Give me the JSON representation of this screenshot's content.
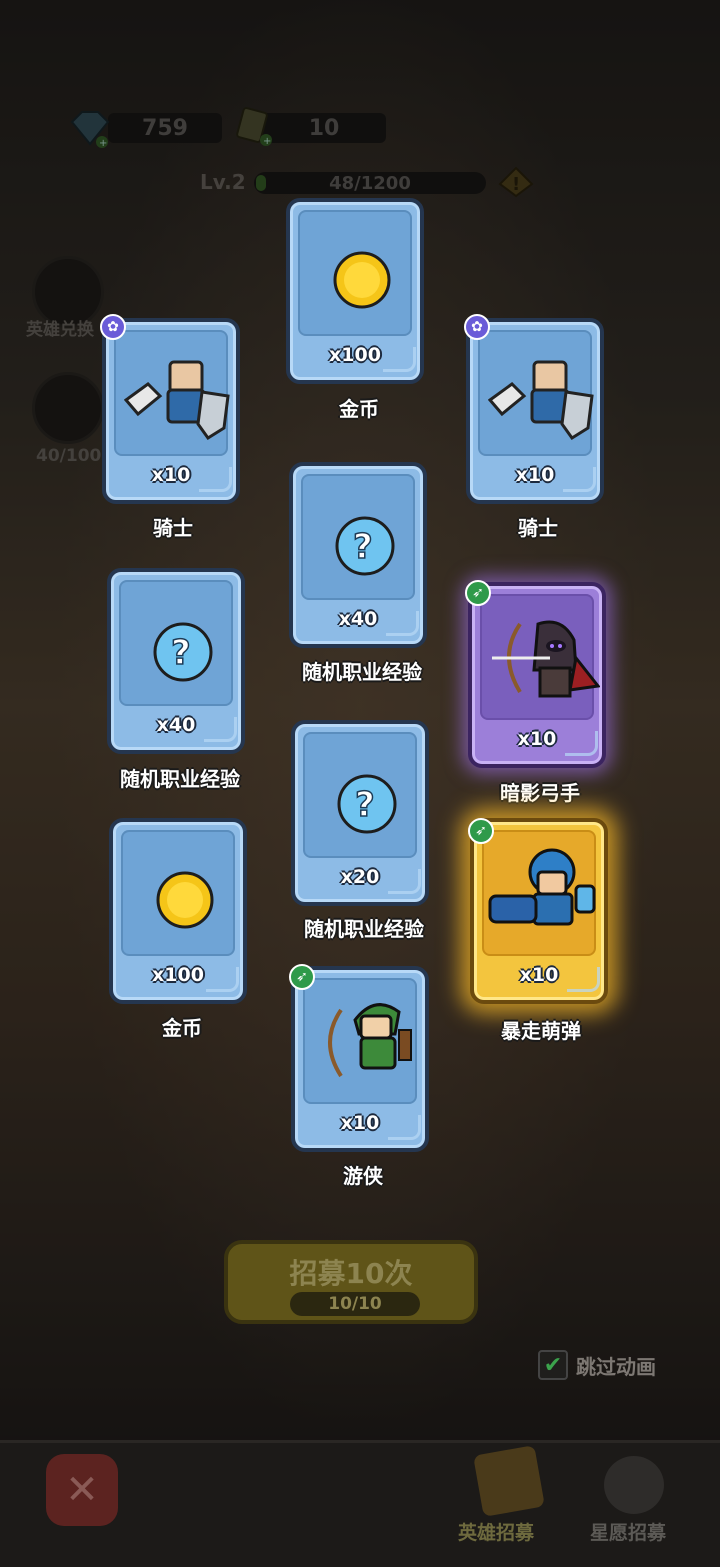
{
  "resources": {
    "gems": "759",
    "tickets": "10"
  },
  "level": {
    "label": "Lv.2",
    "progress_text": "48/1200",
    "progress_fraction": 0.04
  },
  "side": {
    "hero_exchange": "英雄兑换",
    "progress": "40/100"
  },
  "rewards": [
    {
      "name": "金币",
      "qty": "x100",
      "icon": "coin-icon",
      "rarity": "common"
    },
    {
      "name": "骑士",
      "qty": "x10",
      "icon": "knight-icon",
      "rarity": "common",
      "badge": "paw-icon"
    },
    {
      "name": "骑士",
      "qty": "x10",
      "icon": "knight-icon",
      "rarity": "common",
      "badge": "paw-icon"
    },
    {
      "name": "随机职业经验",
      "qty": "x40",
      "icon": "mystery-orb-icon",
      "rarity": "common"
    },
    {
      "name": "随机职业经验",
      "qty": "x40",
      "icon": "mystery-orb-icon",
      "rarity": "common"
    },
    {
      "name": "暗影弓手",
      "qty": "x10",
      "icon": "shadow-archer-icon",
      "rarity": "epic",
      "badge": "bow-icon"
    },
    {
      "name": "随机职业经验",
      "qty": "x20",
      "icon": "mystery-orb-icon",
      "rarity": "common"
    },
    {
      "name": "金币",
      "qty": "x100",
      "icon": "coin-icon",
      "rarity": "common"
    },
    {
      "name": "暴走萌弹",
      "qty": "x10",
      "icon": "cannon-hero-icon",
      "rarity": "legendary",
      "badge": "bow-icon"
    },
    {
      "name": "游侠",
      "qty": "x10",
      "icon": "ranger-icon",
      "rarity": "common",
      "badge": "bow-icon"
    }
  ],
  "recruit": {
    "title": "招募10次",
    "count": "10/10"
  },
  "skip_animation": {
    "label": "跳过动画",
    "checked": true
  },
  "bottom_nav": {
    "hero_recruit": "英雄招募",
    "star_wish": "星愿招募"
  }
}
